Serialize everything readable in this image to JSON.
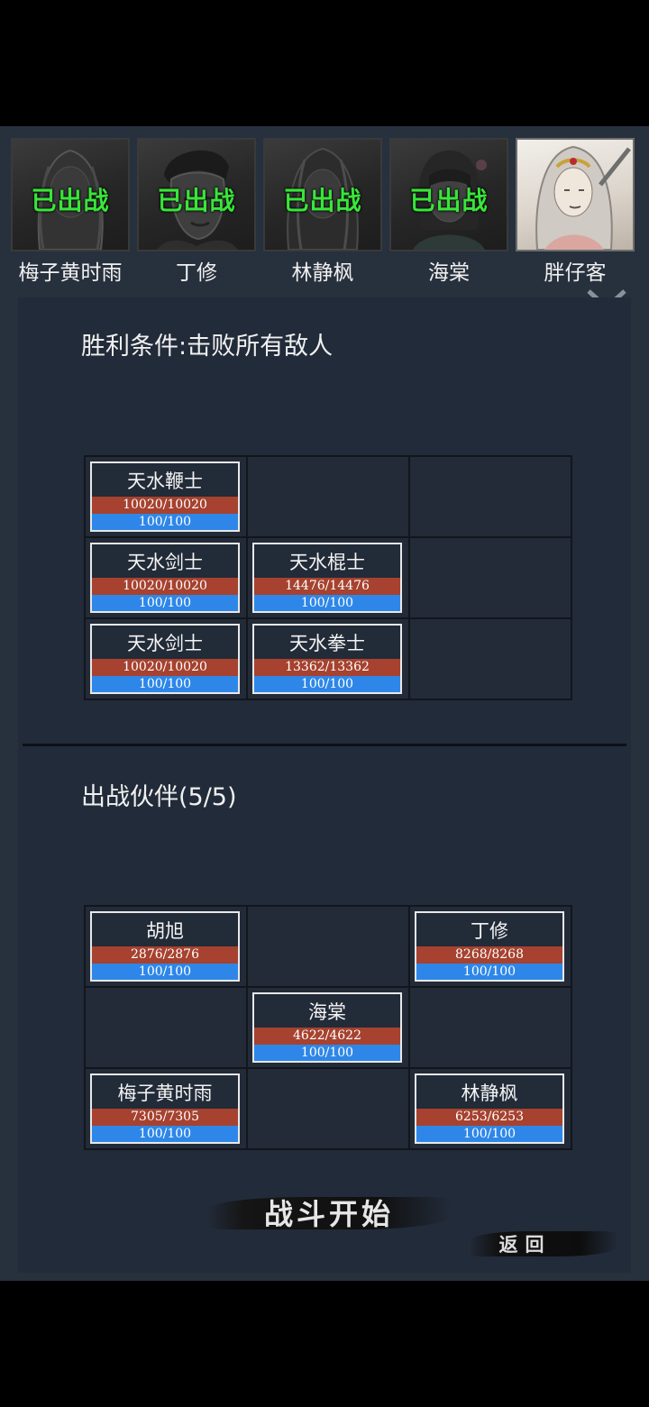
{
  "roster": {
    "slots": [
      {
        "name": "梅子黄时雨",
        "status": "已出战"
      },
      {
        "name": "丁修",
        "status": "已出战"
      },
      {
        "name": "林静枫",
        "status": "已出战"
      },
      {
        "name": "海棠",
        "status": "已出战"
      },
      {
        "name": "胖仔客",
        "status": ""
      }
    ],
    "expand_icon": "chevron-down-icon"
  },
  "victory": {
    "title": "胜利条件:击败所有敌人"
  },
  "enemies": {
    "grid": [
      [
        {
          "name": "天水鞭士",
          "hp": "10020/10020",
          "mp": "100/100"
        },
        null,
        null
      ],
      [
        {
          "name": "天水剑士",
          "hp": "10020/10020",
          "mp": "100/100"
        },
        {
          "name": "天水棍士",
          "hp": "14476/14476",
          "mp": "100/100"
        },
        null
      ],
      [
        {
          "name": "天水剑士",
          "hp": "10020/10020",
          "mp": "100/100"
        },
        {
          "name": "天水拳士",
          "hp": "13362/13362",
          "mp": "100/100"
        },
        null
      ]
    ]
  },
  "party": {
    "title": "出战伙伴(5/5)",
    "grid": [
      [
        {
          "name": "胡旭",
          "hp": "2876/2876",
          "mp": "100/100"
        },
        null,
        {
          "name": "丁修",
          "hp": "8268/8268",
          "mp": "100/100"
        }
      ],
      [
        null,
        {
          "name": "海棠",
          "hp": "4622/4622",
          "mp": "100/100"
        },
        null
      ],
      [
        {
          "name": "梅子黄时雨",
          "hp": "7305/7305",
          "mp": "100/100"
        },
        null,
        {
          "name": "林静枫",
          "hp": "6253/6253",
          "mp": "100/100"
        }
      ]
    ]
  },
  "buttons": {
    "start": "战斗开始",
    "back": "返回"
  },
  "colors": {
    "background": "#27303d",
    "panel": "#222b39",
    "deployed_text": "#39e639",
    "hp_bar": "#a6422f",
    "mp_bar": "#2e87e8"
  }
}
